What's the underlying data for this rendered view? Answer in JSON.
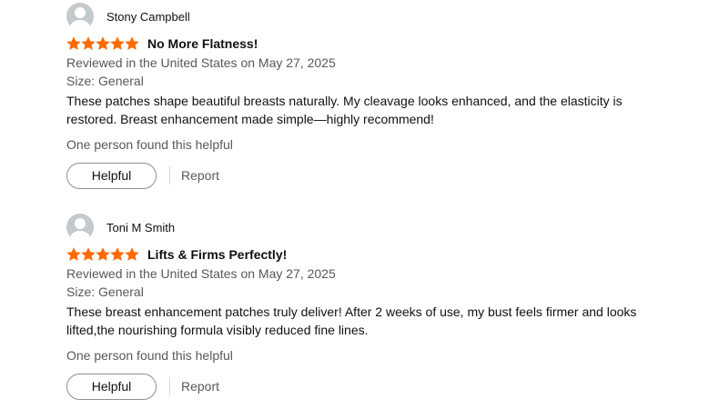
{
  "colors": {
    "star": "#ff6a00",
    "secondary_text": "#565959",
    "primary_text": "#0f1111",
    "button_border": "#8d9096"
  },
  "reviews": [
    {
      "profile_name": "Stony Campbell",
      "avatar_icon": "default-user-avatar-icon",
      "rating": 5,
      "title": "No More Flatness!",
      "date": "Reviewed in the United States on May 27, 2025",
      "size": "Size: General",
      "body": "These patches shape beautiful breasts naturally. My cleavage looks enhanced, and the elasticity is restored. Breast enhancement made simple—highly recommend!",
      "helpful_count": "One person found this helpful",
      "helpful_label": "Helpful",
      "report_label": "Report"
    },
    {
      "profile_name": "Toni M Smith",
      "avatar_icon": "default-user-avatar-icon",
      "rating": 5,
      "title": "Lifts & Firms Perfectly!",
      "date": "Reviewed in the United States on May 27, 2025",
      "size": "Size: General",
      "body": "These breast enhancement patches truly deliver! After 2 weeks of use, my bust feels firmer and looks lifted,the nourishing formula visibly reduced fine lines.",
      "helpful_count": "One person found this helpful",
      "helpful_label": "Helpful",
      "report_label": "Report"
    }
  ]
}
